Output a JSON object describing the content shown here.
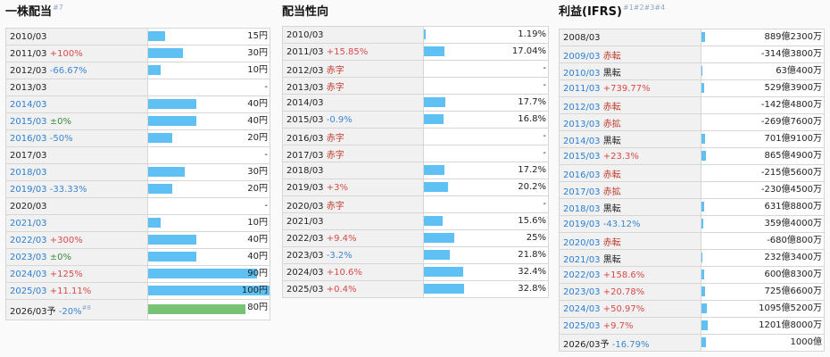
{
  "colors": {
    "bar": "#5ec0f3",
    "forecast_bar": "#78c276",
    "increase": "#d84a4a",
    "decrease": "#3b86d1",
    "flat": "#3a8a3a",
    "year_link": "#2a7fd4"
  },
  "dividend": {
    "title": "一株配当",
    "title_note": "#7",
    "rows": [
      {
        "year": "2010/03",
        "link": false,
        "change": "",
        "dir": "",
        "value": "15円",
        "bar": 0.14
      },
      {
        "year": "2011/03",
        "link": false,
        "change": "+100%",
        "dir": "up",
        "value": "30円",
        "bar": 0.29
      },
      {
        "year": "2012/03",
        "link": false,
        "change": "-66.67%",
        "dir": "dn",
        "value": "10円",
        "bar": 0.1
      },
      {
        "year": "2013/03",
        "link": false,
        "change": "",
        "dir": "",
        "value": "-",
        "bar": 0
      },
      {
        "year": "2014/03",
        "link": true,
        "change": "",
        "dir": "",
        "value": "40円",
        "bar": 0.4
      },
      {
        "year": "2015/03",
        "link": true,
        "change": "±0%",
        "dir": "eq",
        "value": "40円",
        "bar": 0.4
      },
      {
        "year": "2016/03",
        "link": true,
        "change": "-50%",
        "dir": "dn",
        "value": "20円",
        "bar": 0.2
      },
      {
        "year": "2017/03",
        "link": false,
        "change": "",
        "dir": "",
        "value": "-",
        "bar": 0
      },
      {
        "year": "2018/03",
        "link": true,
        "change": "",
        "dir": "",
        "value": "30円",
        "bar": 0.3
      },
      {
        "year": "2019/03",
        "link": true,
        "change": "-33.33%",
        "dir": "dn",
        "value": "20円",
        "bar": 0.2
      },
      {
        "year": "2020/03",
        "link": false,
        "change": "",
        "dir": "",
        "value": "-",
        "bar": 0
      },
      {
        "year": "2021/03",
        "link": true,
        "change": "",
        "dir": "",
        "value": "10円",
        "bar": 0.1
      },
      {
        "year": "2022/03",
        "link": true,
        "change": "+300%",
        "dir": "up",
        "value": "40円",
        "bar": 0.4
      },
      {
        "year": "2023/03",
        "link": true,
        "change": "±0%",
        "dir": "eq",
        "value": "40円",
        "bar": 0.4
      },
      {
        "year": "2024/03",
        "link": true,
        "change": "+125%",
        "dir": "up",
        "value": "90円",
        "bar": 0.9
      },
      {
        "year": "2025/03",
        "link": true,
        "change": "+11.11%",
        "dir": "up",
        "value": "100円",
        "bar": 1.0
      }
    ],
    "forecast": {
      "year": "2026/03予",
      "change": "-20%",
      "change_note": "#8",
      "dir": "dn",
      "value": "80円",
      "bar": 0.8
    }
  },
  "payout": {
    "title": "配当性向",
    "rows": [
      {
        "year": "2010/03",
        "change": "",
        "dir": "",
        "value": "1.19%",
        "bar": 0.015
      },
      {
        "year": "2011/03",
        "change": "+15.85%",
        "dir": "up",
        "value": "17.04%",
        "bar": 0.165
      },
      {
        "year": "2012/03",
        "change": "赤字",
        "dir": "red",
        "value": "-",
        "bar": 0
      },
      {
        "year": "2013/03",
        "change": "赤字",
        "dir": "red",
        "value": "-",
        "bar": 0
      },
      {
        "year": "2014/03",
        "change": "",
        "dir": "",
        "value": "17.7%",
        "bar": 0.17
      },
      {
        "year": "2015/03",
        "change": "-0.9%",
        "dir": "dn",
        "value": "16.8%",
        "bar": 0.16
      },
      {
        "year": "2016/03",
        "change": "赤字",
        "dir": "red",
        "value": "-",
        "bar": 0
      },
      {
        "year": "2017/03",
        "change": "赤字",
        "dir": "red",
        "value": "-",
        "bar": 0
      },
      {
        "year": "2018/03",
        "change": "",
        "dir": "",
        "value": "17.2%",
        "bar": 0.165
      },
      {
        "year": "2019/03",
        "change": "+3%",
        "dir": "up",
        "value": "20.2%",
        "bar": 0.195
      },
      {
        "year": "2020/03",
        "change": "赤字",
        "dir": "red",
        "value": "-",
        "bar": 0
      },
      {
        "year": "2021/03",
        "change": "",
        "dir": "",
        "value": "15.6%",
        "bar": 0.15
      },
      {
        "year": "2022/03",
        "change": "+9.4%",
        "dir": "up",
        "value": "25%",
        "bar": 0.245
      },
      {
        "year": "2023/03",
        "change": "-3.2%",
        "dir": "dn",
        "value": "21.8%",
        "bar": 0.21
      },
      {
        "year": "2024/03",
        "change": "+10.6%",
        "dir": "up",
        "value": "32.4%",
        "bar": 0.32
      },
      {
        "year": "2025/03",
        "change": "+0.4%",
        "dir": "up",
        "value": "32.8%",
        "bar": 0.325
      }
    ]
  },
  "profit": {
    "title": "利益(IFRS)",
    "title_note": "#1#2#3#4",
    "rows": [
      {
        "year": "2008/03",
        "link": false,
        "change": "",
        "dir": "",
        "value": "889億2300万",
        "bar": 0.03
      },
      {
        "year": "2009/03",
        "link": true,
        "change": "赤転",
        "dir": "red",
        "value": "-314億3800万",
        "bar": 0
      },
      {
        "year": "2010/03",
        "link": true,
        "change": "黒転",
        "dir": "blk",
        "value": "63億400万",
        "bar": 0.005
      },
      {
        "year": "2011/03",
        "link": true,
        "change": "+739.77%",
        "dir": "up",
        "value": "529億3900万",
        "bar": 0.02
      },
      {
        "year": "2012/03",
        "link": true,
        "change": "赤転",
        "dir": "red",
        "value": "-142億4800万",
        "bar": 0
      },
      {
        "year": "2013/03",
        "link": true,
        "change": "赤拡",
        "dir": "red",
        "value": "-269億7600万",
        "bar": 0
      },
      {
        "year": "2014/03",
        "link": true,
        "change": "黒転",
        "dir": "blk",
        "value": "701億9100万",
        "bar": 0.03
      },
      {
        "year": "2015/03",
        "link": true,
        "change": "+23.3%",
        "dir": "up",
        "value": "865億4900万",
        "bar": 0.035
      },
      {
        "year": "2016/03",
        "link": true,
        "change": "赤転",
        "dir": "red",
        "value": "-215億5600万",
        "bar": 0
      },
      {
        "year": "2017/03",
        "link": true,
        "change": "赤拡",
        "dir": "red",
        "value": "-230億4500万",
        "bar": 0
      },
      {
        "year": "2018/03",
        "link": true,
        "change": "黒転",
        "dir": "blk",
        "value": "631億8800万",
        "bar": 0.025
      },
      {
        "year": "2019/03",
        "link": true,
        "change": "-43.12%",
        "dir": "dn",
        "value": "359億4000万",
        "bar": 0.015
      },
      {
        "year": "2020/03",
        "link": true,
        "change": "赤転",
        "dir": "red",
        "value": "-680億800万",
        "bar": 0
      },
      {
        "year": "2021/03",
        "link": true,
        "change": "黒転",
        "dir": "blk",
        "value": "232億3400万",
        "bar": 0.01
      },
      {
        "year": "2022/03",
        "link": true,
        "change": "+158.6%",
        "dir": "up",
        "value": "600億8300万",
        "bar": 0.025
      },
      {
        "year": "2023/03",
        "link": true,
        "change": "+20.78%",
        "dir": "up",
        "value": "725億6600万",
        "bar": 0.03
      },
      {
        "year": "2024/03",
        "link": true,
        "change": "+50.97%",
        "dir": "up",
        "value": "1095億5200万",
        "bar": 0.045
      },
      {
        "year": "2025/03",
        "link": true,
        "change": "+9.7%",
        "dir": "up",
        "value": "1201億8000万",
        "bar": 0.05
      }
    ],
    "forecast": {
      "year": "2026/03予",
      "change": "-16.79%",
      "dir": "dn",
      "value": "1000億",
      "bar": 0.04
    }
  }
}
